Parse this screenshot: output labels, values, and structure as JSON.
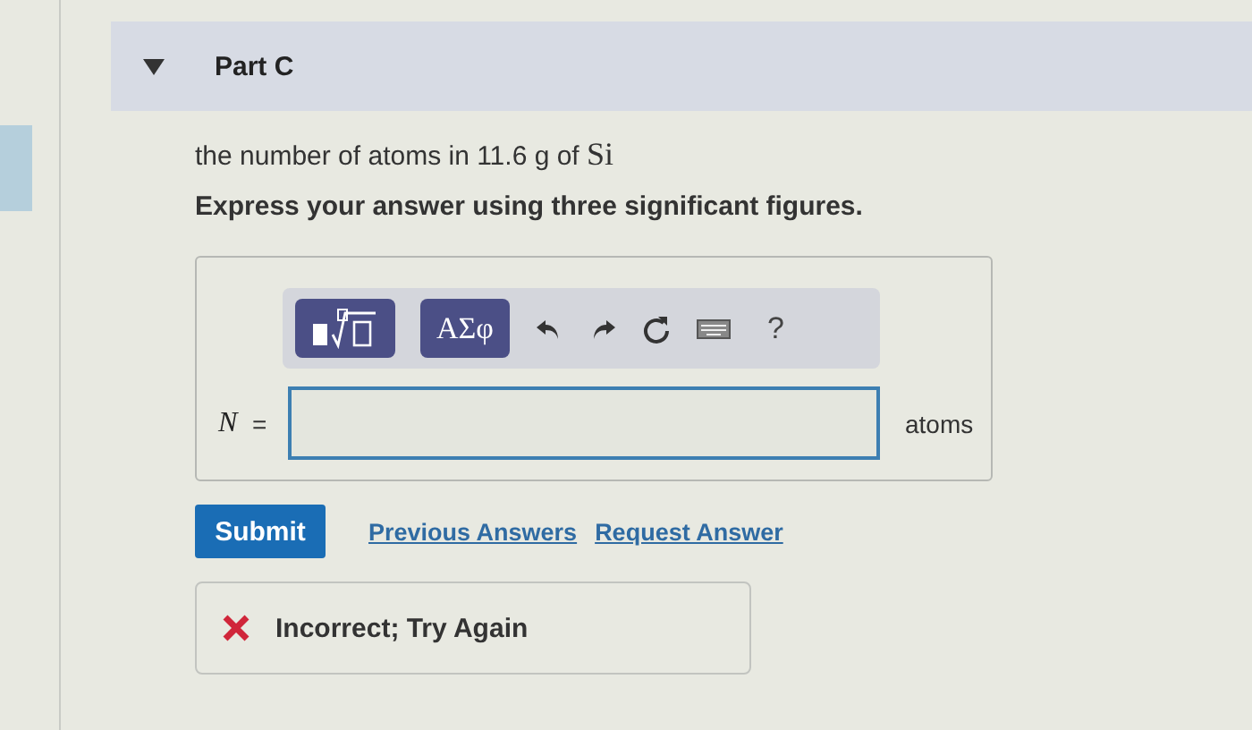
{
  "part": {
    "title": "Part C",
    "expanded": true
  },
  "question": {
    "prompt": "the number of atoms in 11.6 g of ",
    "element": "Si",
    "instruction": "Express your answer using three significant figures."
  },
  "toolbar": {
    "greek_button": "ΑΣφ",
    "help": "?"
  },
  "answer": {
    "variable": "N",
    "equals": "=",
    "unit": "atoms"
  },
  "actions": {
    "submit": "Submit",
    "links": [
      "Previous Answers",
      "Request Answer"
    ]
  },
  "feedback": {
    "correct": false,
    "message": "Incorrect; Try Again"
  }
}
